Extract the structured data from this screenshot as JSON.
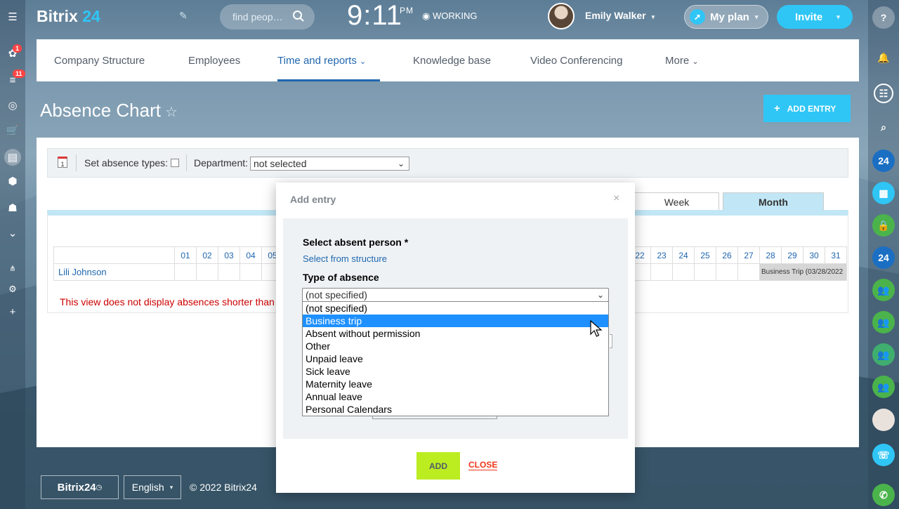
{
  "header": {
    "logo_main": "Bitrix",
    "logo_num": "24",
    "search_placeholder": "find peop…",
    "time": "9:11",
    "ampm": "PM",
    "status": "WORKING",
    "user_name": "Emily Walker",
    "my_plan": "My plan",
    "invite": "Invite"
  },
  "left_badges": {
    "first": "1",
    "second": "11"
  },
  "nav": {
    "items": [
      "Company Structure",
      "Employees",
      "Time and reports",
      "Knowledge base",
      "Video Conferencing",
      "More"
    ],
    "active_index": 2
  },
  "page": {
    "title": "Absence Chart",
    "add_entry": "ADD ENTRY",
    "set_absence_types": "Set absence types:",
    "department_label": "Department:",
    "department_value": "not selected",
    "tabs": {
      "week": "Week",
      "month": "Month"
    },
    "calendar_days_left": [
      "01",
      "02",
      "03",
      "04",
      "05"
    ],
    "calendar_days_right": [
      "22",
      "23",
      "24",
      "25",
      "26",
      "27",
      "28",
      "29",
      "30",
      "31"
    ],
    "person": "Lili Johnson",
    "event": "Business Trip (03/28/2022",
    "footnote": "This view does not display absences shorter than a d"
  },
  "modal": {
    "title": "Add entry",
    "close_x": "×",
    "select_person_label": "Select absent person *",
    "select_from_structure": "Select from structure",
    "type_label": "Type of absence",
    "type_value": "(not specified)",
    "options": [
      "(not specified)",
      "Business trip",
      "Absent without permission",
      "Other",
      "Unpaid leave",
      "Sick leave",
      "Maternity leave",
      "Annual leave",
      "Personal Calendars"
    ],
    "highlighted_index": 1,
    "add_button": "ADD",
    "close_button": "CLOSE"
  },
  "footer": {
    "logo": "Bitrix24",
    "language": "English",
    "copyright": "© 2022 Bitrix24"
  },
  "right_bar": {
    "badge_24": "24"
  },
  "colors": {
    "accent_blue": "#2fc6f6",
    "link_blue": "#2067b0",
    "add_green": "#bbed21",
    "close_red": "#f0371b",
    "highlight": "#1e90ff"
  }
}
